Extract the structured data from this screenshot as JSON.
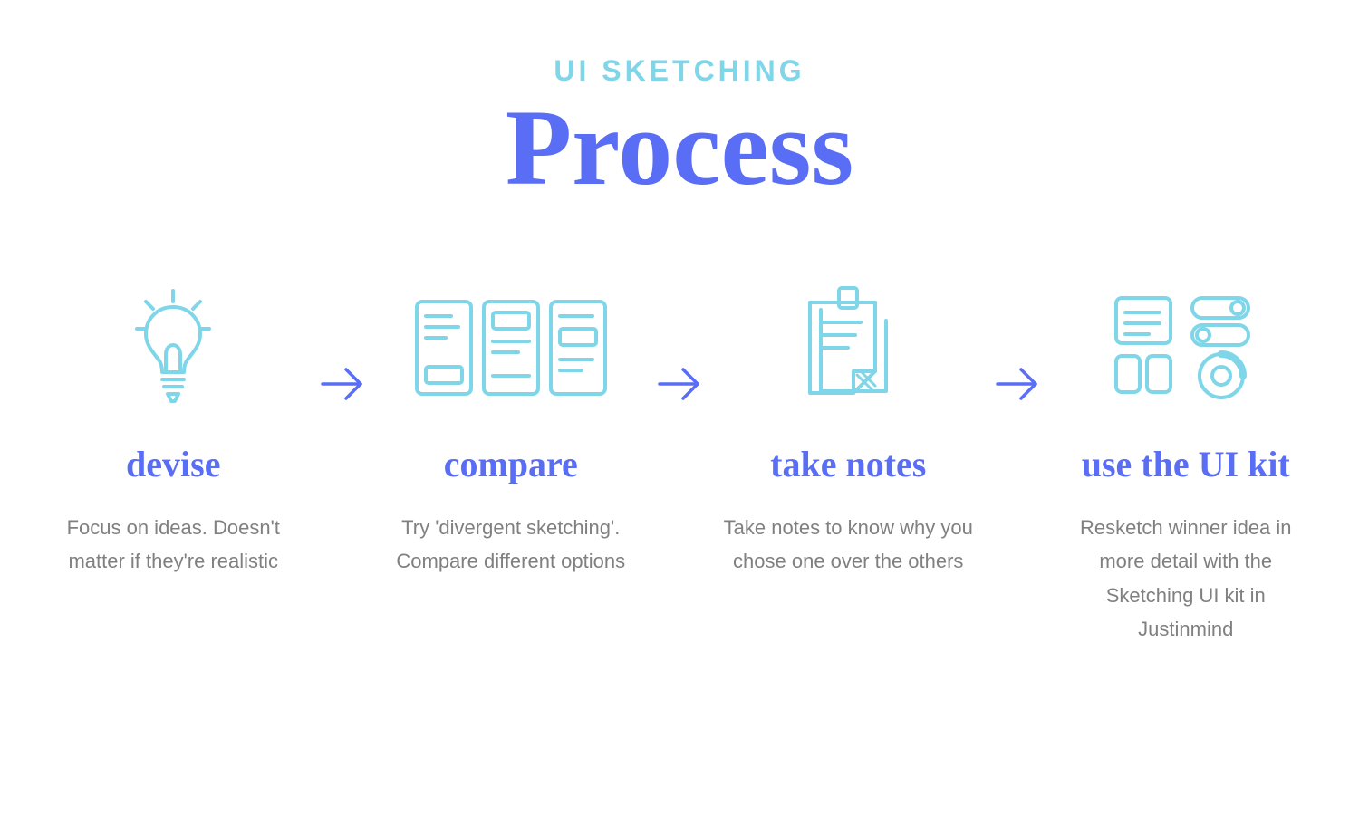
{
  "header": {
    "subtitle": "UI SKETCHING",
    "title": "Process"
  },
  "steps": [
    {
      "icon": "lightbulb-icon",
      "heading": "devise",
      "desc": "Focus on ideas. Doesn't matter if they're realistic"
    },
    {
      "icon": "wireframes-icon",
      "heading": "compare",
      "desc": "Try 'divergent sketching'. Compare different options"
    },
    {
      "icon": "note-icon",
      "heading": "take notes",
      "desc": "Take notes to know why you chose one over the others"
    },
    {
      "icon": "ui-kit-icon",
      "heading": "use the UI kit",
      "desc": "Resketch winner idea in more detail with the Sketching UI kit in Justinmind"
    }
  ],
  "colors": {
    "accent_cyan": "#7ed6e8",
    "accent_blue": "#5a6ef5",
    "gray_text": "#808080"
  }
}
